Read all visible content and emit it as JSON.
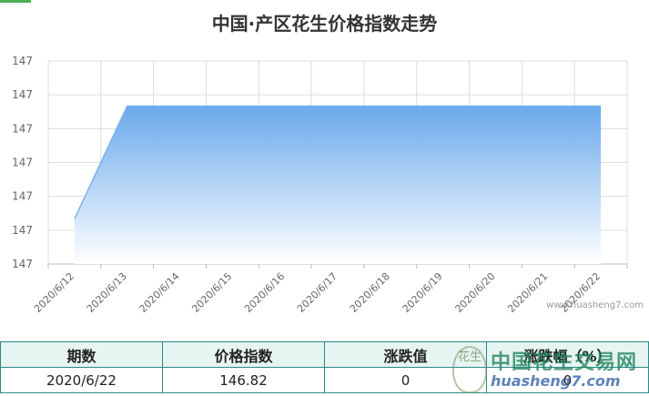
{
  "chart_data": {
    "type": "area",
    "title": "中国·产区花生价格指数走势",
    "categories": [
      "2020/6/12",
      "2020/6/13",
      "2020/6/14",
      "2020/6/15",
      "2020/6/16",
      "2020/6/17",
      "2020/6/18",
      "2020/6/19",
      "2020/6/20",
      "2020/6/21",
      "2020/6/22"
    ],
    "series": [
      {
        "values": [
          146.77,
          146.82,
          146.82,
          146.82,
          146.82,
          146.82,
          146.82,
          146.82,
          146.82,
          146.82,
          146.82
        ]
      }
    ],
    "y_tick_labels": [
      "147",
      "147",
      "147",
      "147",
      "147",
      "147",
      "147"
    ],
    "ylim": [
      146.75,
      146.84
    ],
    "grid": true,
    "legend": "none",
    "colors": {
      "fill_top": "#6aa9ec",
      "fill_bottom": "#ffffff",
      "line": "#7db2ea"
    }
  },
  "watermark": "www.huasheng7.com",
  "table": {
    "headers": [
      "期数",
      "价格指数",
      "涨跌值",
      "涨跌幅（%）"
    ],
    "row": [
      "2020/6/22",
      "146.82",
      "0",
      "0"
    ]
  },
  "brand": {
    "logo_text": "花生",
    "name": "中国花生交易网",
    "url": "huasheng7.com"
  }
}
